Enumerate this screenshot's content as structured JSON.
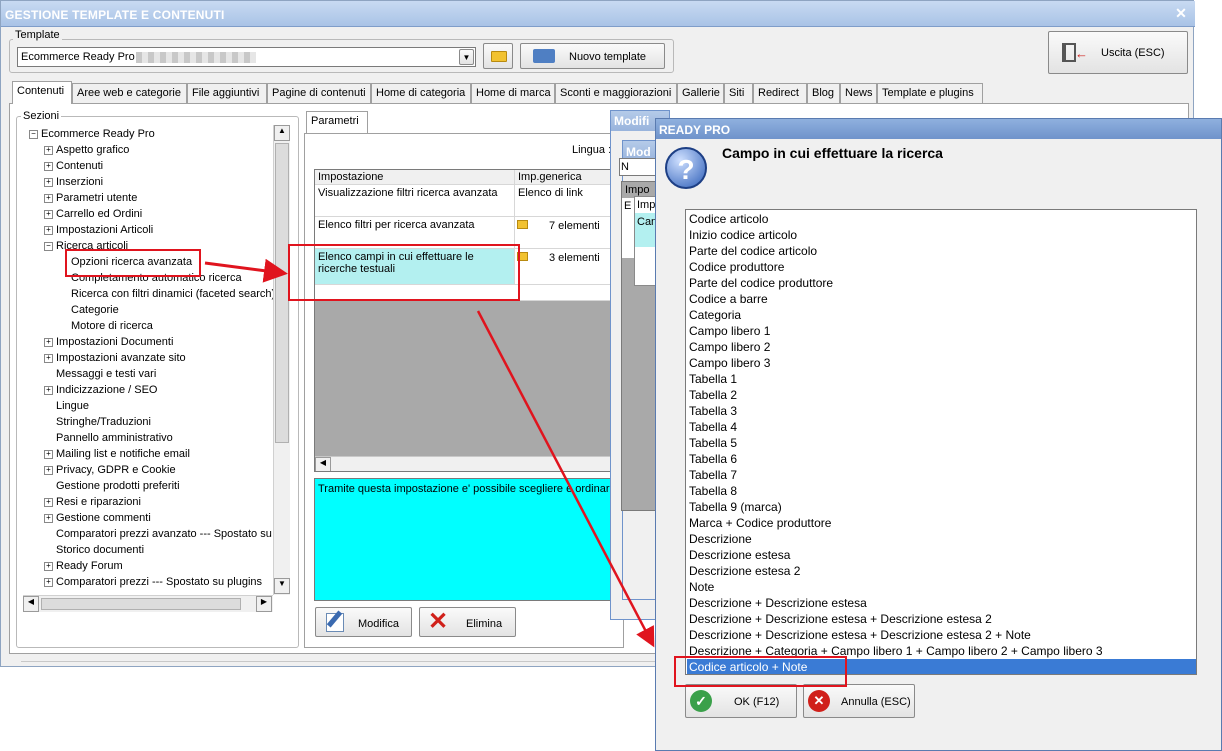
{
  "main_window": {
    "title": "GESTIONE TEMPLATE E CONTENUTI",
    "template_label": "Template",
    "template_value": "Ecommerce Ready Pro",
    "new_template_label": "Nuovo template",
    "exit_label": "Uscita (ESC)"
  },
  "tabs": [
    "Contenuti",
    "Aree web e categorie",
    "File aggiuntivi",
    "Pagine di contenuti",
    "Home di categoria",
    "Home di marca",
    "Sconti e maggiorazioni",
    "Gallerie",
    "Siti",
    "Redirect",
    "Blog",
    "News",
    "Template e plugins"
  ],
  "sections": {
    "label": "Sezioni",
    "root": "Ecommerce Ready Pro",
    "items": [
      "Aspetto grafico",
      "Contenuti",
      "Inserzioni",
      "Parametri utente",
      "Carrello ed Ordini",
      "Impostazioni Articoli",
      "Ricerca articoli"
    ],
    "sub_items": [
      "Opzioni ricerca avanzata",
      "Completamento automatico ricerca",
      "Ricerca con filtri dinamici (faceted search)",
      "Categorie",
      "Motore di ricerca"
    ],
    "items_after": [
      "Impostazioni Documenti",
      "Impostazioni avanzate sito",
      "Messaggi e testi vari",
      "Indicizzazione / SEO",
      "Lingue",
      "Stringhe/Traduzioni",
      "Pannello amministrativo",
      "Mailing list e notifiche email",
      "Privacy, GDPR e Cookie",
      "Gestione prodotti preferiti",
      "Resi e riparazioni",
      "Gestione commenti",
      "Comparatori prezzi avanzato --- Spostato su",
      "Storico documenti",
      "Ready Forum",
      "Comparatori prezzi --- Spostato su plugins"
    ]
  },
  "params_panel": {
    "tab": "Parametri",
    "lingua_label": "Lingua :",
    "col_setting": "Impostazione",
    "col_generic": "Imp.generica",
    "rows": [
      {
        "setting": "Visualizzazione filtri ricerca avanzata",
        "value": "Elenco di link"
      },
      {
        "setting": "Elenco filtri per ricerca avanzata",
        "value": "7 elementi"
      },
      {
        "setting": "Elenco campi in cui effettuare le ricerche testuali",
        "value": "3 elementi"
      }
    ],
    "description": "Tramite questa impostazione e' possibile scegliere e ordinare i",
    "edit_label": "Modifica",
    "delete_label": "Elimina"
  },
  "bg_dialogs": {
    "modifica_title": "Modifi",
    "mod_title": "Mod",
    "nc": "N",
    "impo": "Impo",
    "imp": "Imp",
    "can": "Can",
    "e": "E"
  },
  "dialog": {
    "title": "READY PRO",
    "heading": "Campo in cui effettuare la ricerca",
    "options": [
      "Codice articolo",
      "Inizio codice articolo",
      "Parte del codice articolo",
      "Codice produttore",
      "Parte del codice produttore",
      "Codice a barre",
      "Categoria",
      "Campo libero 1",
      "Campo libero 2",
      "Campo libero 3",
      "Tabella 1",
      "Tabella 2",
      "Tabella 3",
      "Tabella 4",
      "Tabella 5",
      "Tabella 6",
      "Tabella 7",
      "Tabella 8",
      "Tabella 9 (marca)",
      "Marca + Codice produttore",
      "Descrizione",
      "Descrizione estesa",
      "Descrizione estesa 2",
      "Note",
      "Descrizione + Descrizione estesa",
      "Descrizione + Descrizione estesa + Descrizione estesa 2",
      "Descrizione + Descrizione estesa + Descrizione estesa 2 + Note",
      "Descrizione + Categoria + Campo libero 1 + Campo libero 2 + Campo libero 3",
      "Codice articolo + Note"
    ],
    "selected_index": 28,
    "ok_label": "OK (F12)",
    "cancel_label": "Annulla (ESC)"
  },
  "colors": {
    "highlight": "#b3f0f0",
    "selection": "#3a7bd5",
    "annotation": "#e0141e",
    "cyan_desc": "#00ffff"
  }
}
